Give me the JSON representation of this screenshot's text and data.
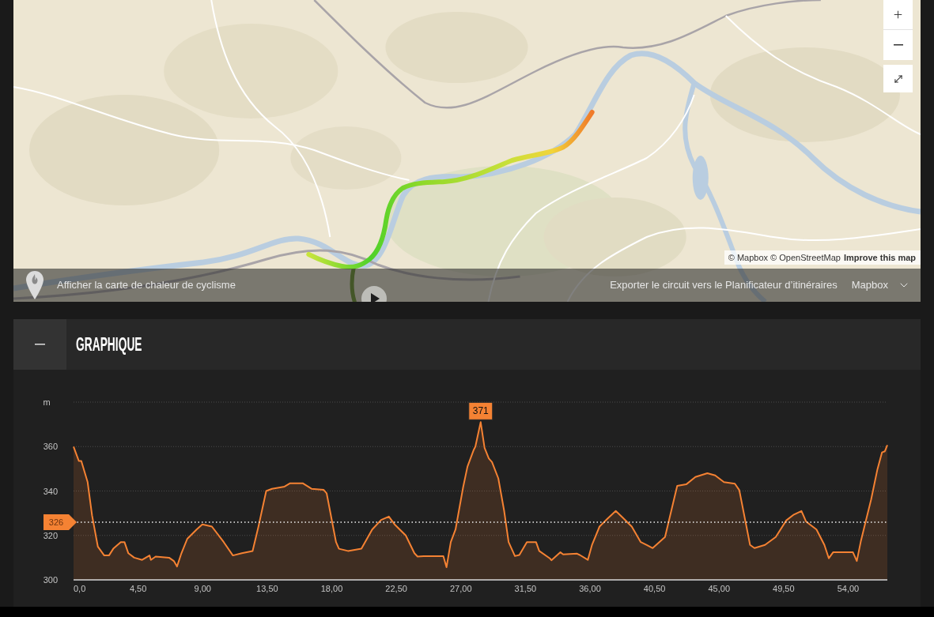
{
  "map": {
    "attribution": {
      "text": "© Mapbox © OpenStreetMap",
      "link": "Improve this map"
    },
    "heatmap_toggle": {
      "label": "Afficher la carte de chaleur de cyclisme"
    },
    "export_link": "Exporter le circuit vers le Planificateur d’itinéraires",
    "style_select": {
      "value": "Mapbox"
    }
  },
  "chart_panel": {
    "title": "GRAPHIQUE",
    "expanded": true,
    "chart_data": {
      "type": "area",
      "ylabel": "m",
      "x": [
        0,
        0.37,
        0.54,
        0.98,
        1.29,
        1.69,
        2.14,
        2.47,
        2.77,
        3.29,
        3.55,
        3.82,
        4.23,
        4.78,
        5.3,
        5.39,
        5.72,
        6.66,
        6.99,
        7.21,
        7.52,
        7.93,
        8.58,
        8.98,
        9.64,
        10.47,
        11.11,
        11.73,
        12.48,
        12.89,
        13.43,
        13.83,
        14.71,
        15.1,
        15.97,
        16.59,
        17.44,
        17.64,
        18.3,
        18.5,
        19.13,
        20.07,
        20.82,
        21.44,
        21.98,
        22.38,
        23.16,
        23.76,
        23.98,
        24.41,
        25.78,
        26.0,
        26.3,
        26.63,
        27.16,
        27.46,
        27.9,
        28.01,
        28.38,
        28.65,
        28.95,
        29.17,
        29.61,
        30.02,
        30.33,
        30.77,
        31.08,
        31.6,
        32.24,
        32.46,
        33.2,
        33.31,
        33.94,
        34.13,
        35.1,
        35.29,
        35.85,
        36.15,
        36.67,
        37.21,
        37.8,
        38.27,
        38.91,
        39.54,
        39.96,
        40.37,
        41.23,
        42.08,
        42.71,
        43.35,
        44.18,
        44.73,
        45.34,
        46.1,
        46.41,
        47.16,
        47.47,
        48.2,
        48.95,
        49.69,
        50.22,
        50.74,
        51.07,
        51.79,
        52.34,
        52.65,
        52.95,
        54.33,
        54.6,
        54.88,
        55.19,
        55.6,
        56.04,
        56.36,
        56.56,
        56.73
      ],
      "series": [
        {
          "color": "#f58233",
          "values": [
            360,
            353.5,
            353.5,
            344,
            329,
            315,
            311,
            311,
            314,
            317,
            317,
            312,
            310,
            309,
            311,
            309,
            310.5,
            310,
            308.5,
            306,
            312,
            318.5,
            322.7,
            325,
            324,
            317,
            311,
            312,
            313,
            324,
            340,
            341,
            342,
            343.5,
            343.5,
            341,
            340.5,
            339,
            317,
            314,
            313,
            314,
            322.7,
            327,
            328.5,
            325,
            320,
            312,
            310.5,
            310.7,
            310.7,
            305.7,
            317,
            322.7,
            341.7,
            351,
            358.6,
            360,
            371,
            359.4,
            354.6,
            353,
            345.7,
            331,
            317,
            310.7,
            311.2,
            317,
            317,
            313,
            309.7,
            308.8,
            312.4,
            311.5,
            311.8,
            311.2,
            309,
            315.9,
            324,
            327.5,
            331,
            328.1,
            324,
            317,
            315.7,
            314.3,
            319.3,
            342.3,
            343,
            346.3,
            348,
            347,
            344,
            343.3,
            340.4,
            315.7,
            314.3,
            315.7,
            319.3,
            326.8,
            329.4,
            331,
            326.2,
            322.7,
            315.7,
            309.7,
            312.4,
            312.4,
            308.5,
            317.2,
            325.5,
            336.2,
            349.8,
            357.4,
            357.9,
            360.7
          ]
        }
      ],
      "xlim": [
        0,
        56.73
      ],
      "ylim": [
        300,
        380
      ],
      "xticks": [
        {
          "value": 0,
          "label": "0,0"
        },
        {
          "value": 4.5,
          "label": "4,50"
        },
        {
          "value": 9,
          "label": "9,00"
        },
        {
          "value": 13.5,
          "label": "13,50"
        },
        {
          "value": 18,
          "label": "18,00"
        },
        {
          "value": 22.5,
          "label": "22,50"
        },
        {
          "value": 27,
          "label": "27,00"
        },
        {
          "value": 31.5,
          "label": "31,50"
        },
        {
          "value": 36,
          "label": "36,00"
        },
        {
          "value": 40.5,
          "label": "40,50"
        },
        {
          "value": 45,
          "label": "45,00"
        },
        {
          "value": 49.5,
          "label": "49,50"
        },
        {
          "value": 54,
          "label": "54,00"
        }
      ],
      "yticks": [
        300,
        320,
        340,
        360
      ],
      "grid": true,
      "annotations": [
        {
          "text": "371"
        }
      ],
      "ref_lines": [
        {
          "axis": "y",
          "value": 326,
          "label": "326"
        }
      ]
    }
  }
}
